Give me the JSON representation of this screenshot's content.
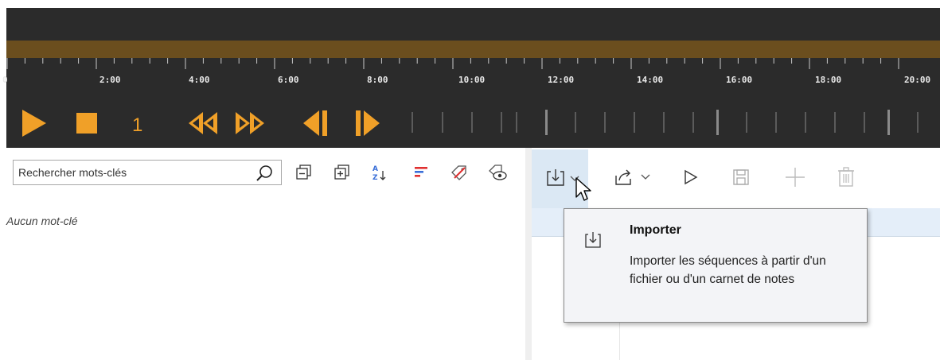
{
  "timeline": {
    "ruler_labels": [
      "0",
      "2:00",
      "4:00",
      "6:00",
      "8:00",
      "10:00",
      "12:00",
      "14:00",
      "16:00",
      "18:00",
      "20:00"
    ]
  },
  "transport": {
    "loop_count": "1",
    "icons": [
      "play-icon",
      "stop-icon",
      "rewind-icon",
      "fast-forward-icon",
      "previous-marker-icon",
      "next-marker-icon"
    ]
  },
  "keywords": {
    "search_placeholder": "Rechercher mots-clés",
    "empty_message": "Aucun mot-clé",
    "toolbar_icons": [
      "collapse-all-icon",
      "expand-all-icon",
      "sort-alpha-icon",
      "sort-frequency-icon",
      "remove-tag-icon",
      "visibility-tag-icon"
    ]
  },
  "sequences": {
    "toolbar_icons": [
      "import-icon",
      "export-icon",
      "play-icon",
      "save-icon",
      "add-icon",
      "delete-icon"
    ]
  },
  "tooltip": {
    "title": "Importer",
    "body": "Importer les séquences à partir d'un fichier ou d'un carnet de notes"
  },
  "colors": {
    "accent": "#f0a028",
    "timeline_bg": "#2b2b2b",
    "timeline_band": "#6b4e1e",
    "hover": "#dbe8f4",
    "accent_red": "#e03030",
    "accent_blue": "#3a6fd8"
  }
}
